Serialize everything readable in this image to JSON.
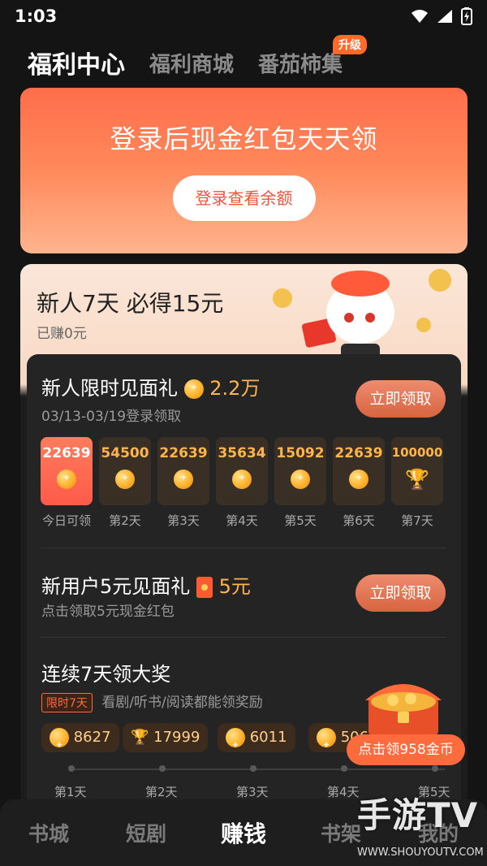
{
  "status": {
    "time": "1:03"
  },
  "tabs": [
    {
      "label": "福利中心",
      "active": true
    },
    {
      "label": "福利商城",
      "active": false
    },
    {
      "label": "番茄柿集",
      "active": false,
      "badge": "升级"
    }
  ],
  "login_card": {
    "title": "登录后现金红包天天领",
    "button": "登录查看余额"
  },
  "newbie": {
    "title": "新人7天 必得15元",
    "earned": "已赚0元"
  },
  "gift": {
    "title": "新人限时见面礼",
    "amount": "2.2万",
    "date_range": "03/13-03/19登录领取",
    "button": "立即领取",
    "days": [
      {
        "value": "22639",
        "label": "今日可领",
        "icon": "coin-icon",
        "today": true
      },
      {
        "value": "54500",
        "label": "第2天",
        "icon": "coin-icon"
      },
      {
        "value": "22639",
        "label": "第3天",
        "icon": "coin-icon"
      },
      {
        "value": "35634",
        "label": "第4天",
        "icon": "coin-icon"
      },
      {
        "value": "15092",
        "label": "第5天",
        "icon": "coin-icon"
      },
      {
        "value": "22639",
        "label": "第6天",
        "icon": "coin-icon"
      },
      {
        "value": "100000",
        "label": "第7天",
        "icon": "trophy-icon"
      }
    ]
  },
  "new_user": {
    "title": "新用户5元见面礼",
    "amount": "5元",
    "subtitle": "点击领取5元现金红包",
    "button": "立即领取"
  },
  "streak": {
    "title": "连续7天领大奖",
    "tag": "限时7天",
    "subtitle": "看剧/听书/阅读都能领奖励",
    "items": [
      {
        "value": "8627",
        "label": "第1天",
        "icon": "coin-icon"
      },
      {
        "value": "17999",
        "label": "第2天",
        "icon": "trophy-icon"
      },
      {
        "value": "6011",
        "label": "第3天",
        "icon": "coin-icon"
      },
      {
        "value": "506",
        "label": "第4天",
        "icon": "coin-icon"
      },
      {
        "value": "",
        "label": "第5天",
        "icon": "coin-icon"
      }
    ],
    "chest_tip": "点击领958金币"
  },
  "bottom_nav": [
    {
      "label": "书城",
      "active": false
    },
    {
      "label": "短剧",
      "active": false
    },
    {
      "label": "赚钱",
      "active": true
    },
    {
      "label": "书架",
      "active": false
    },
    {
      "label": "我的",
      "active": false
    }
  ],
  "watermark": {
    "logo": "手游TV",
    "url": "WWW.SHOUYOUTV.COM"
  }
}
